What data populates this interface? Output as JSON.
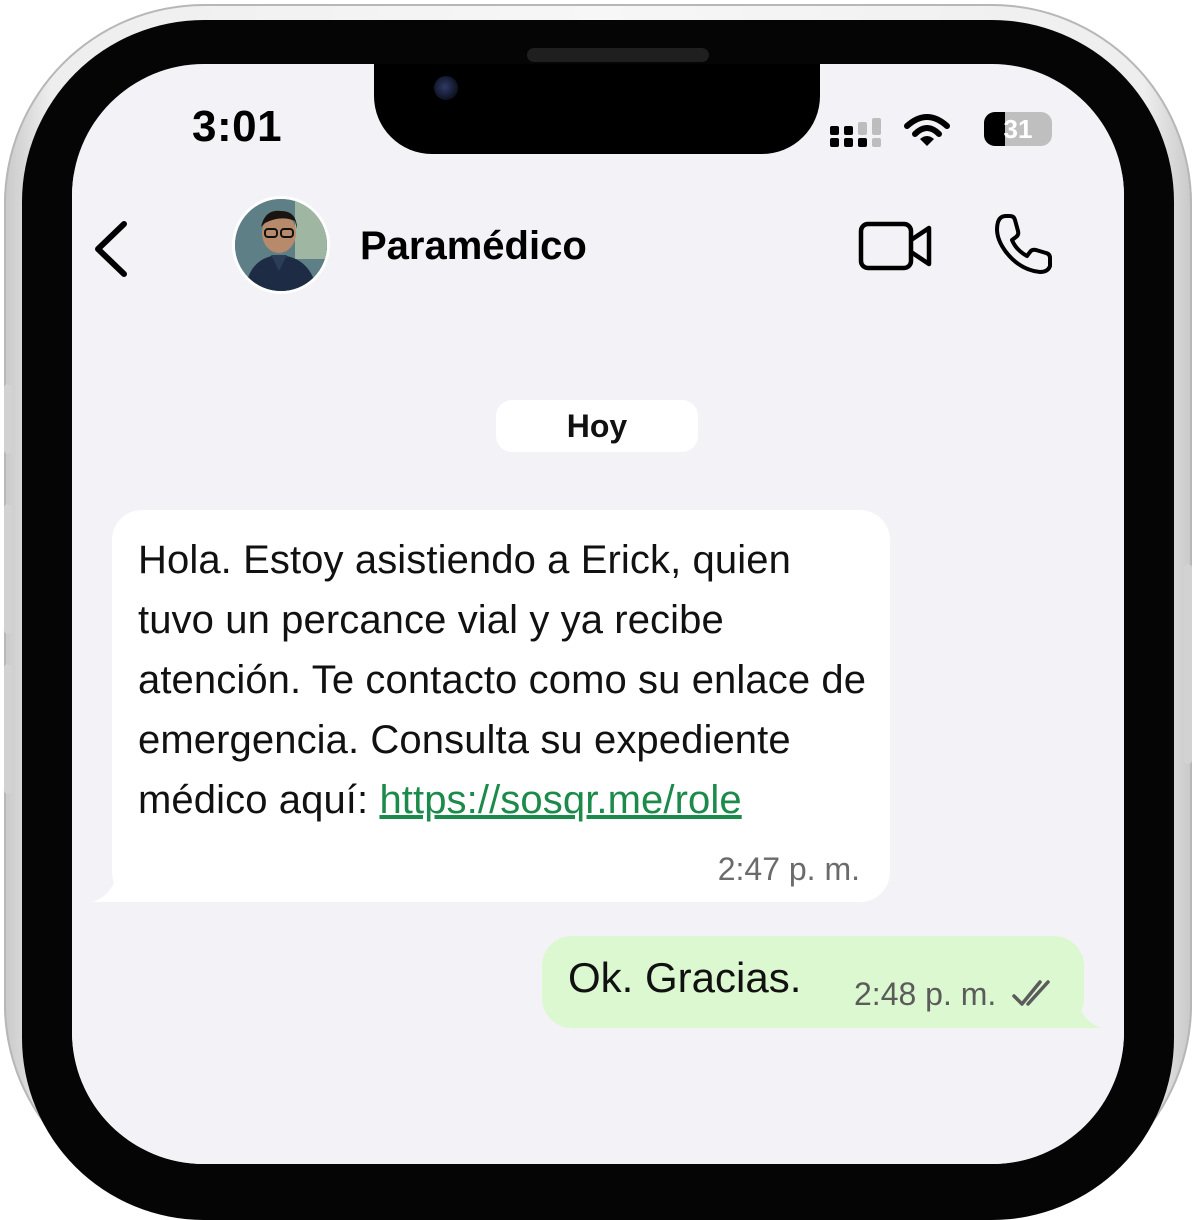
{
  "status_bar": {
    "time": "3:01",
    "battery_level": "31"
  },
  "header": {
    "contact_name": "Paramédico",
    "icons": [
      "chevron-left-icon",
      "avatar",
      "video-camera-icon",
      "phone-icon"
    ]
  },
  "chat": {
    "date_label": "Hoy",
    "messages": [
      {
        "direction": "incoming",
        "text": "Hola. Estoy asistiendo a Erick, quien tuvo un percance vial y ya recibe atención. Te contacto como su enlace de emergencia. Consulta su expediente médico aquí: ",
        "link": "https://sosqr.me/role",
        "time": "2:47",
        "time_suffix": "p. m."
      },
      {
        "direction": "outgoing",
        "text": "Ok. Gracias.",
        "time": "2:48",
        "time_suffix": "p. m.",
        "status_icon": "double-check-icon"
      }
    ]
  },
  "colors": {
    "screen_bg": "#f2f2f7",
    "incoming_bubble": "#ffffff",
    "outgoing_bubble": "#dcf8d0",
    "link": "#1c8a4a"
  }
}
